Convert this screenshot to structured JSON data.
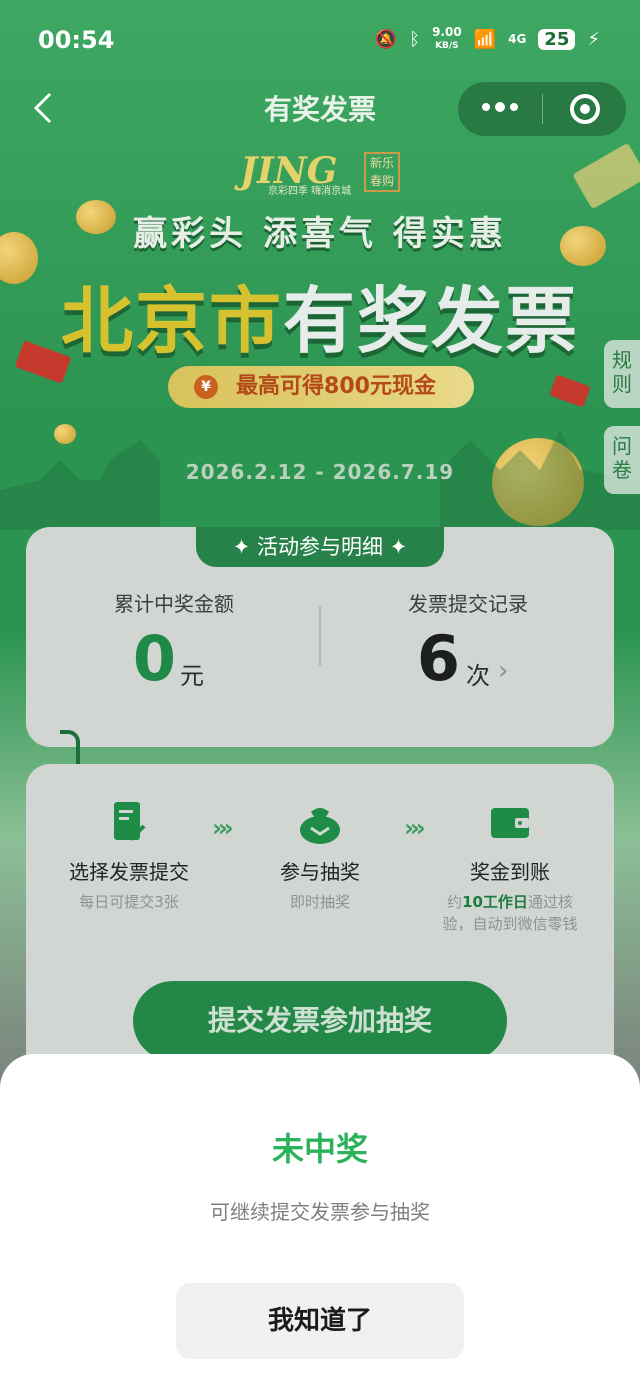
{
  "status_bar": {
    "time": "00:54",
    "speed_value": "9.00",
    "speed_unit": "KB/S",
    "network": "4G",
    "battery": "25"
  },
  "nav": {
    "title": "有奖发票",
    "back_icon": "back-chevron-icon",
    "menu_icon": "more-dots-icon",
    "close_icon": "target-circle-icon"
  },
  "banner": {
    "logo_text": "JING",
    "logo_sub": "京彩四季 嗨消京城",
    "stamp_text": "新乐春购",
    "slogan": "赢彩头 添喜气 得实惠",
    "headline_part1": "北京市",
    "headline_part2": "有奖发票",
    "prize_text": "最高可得800元现金",
    "prize_symbol": "¥",
    "dates": "2026.2.12 - 2026.7.19"
  },
  "side_tabs": {
    "rules": "规则",
    "survey": "问卷"
  },
  "stats": {
    "section_title": "✦ 活动参与明细 ✦",
    "total_prize_label": "累计中奖金额",
    "total_prize_value": "0",
    "total_prize_unit": "元",
    "records_label": "发票提交记录",
    "records_value": "6",
    "records_unit": "次"
  },
  "steps": [
    {
      "icon": "invoice-check-icon",
      "title": "选择发票提交",
      "sub": "每日可提交3张"
    },
    {
      "icon": "money-bag-icon",
      "title": "参与抽奖",
      "sub": "即时抽奖"
    },
    {
      "icon": "wallet-icon",
      "title": "奖金到账",
      "sub_prefix": "约",
      "sub_highlight": "10工作日",
      "sub_suffix": "通过核验，自动到微信零钱"
    }
  ],
  "submit_button": "提交发票参加抽奖",
  "result_sheet": {
    "title": "未中奖",
    "subtitle": "可继续提交发票参与抽奖",
    "confirm_button": "我知道了"
  },
  "colors": {
    "brand_green": "#2bb35c",
    "dark_green": "#238748",
    "gold": "#d6c22f"
  }
}
